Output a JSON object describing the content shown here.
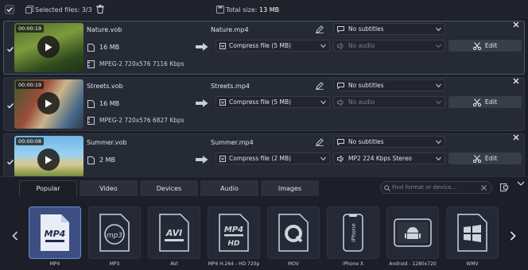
{
  "topbar": {
    "selected_label": "Selected files: 3/3",
    "total_label": "Total size:",
    "total_value": "13 MB"
  },
  "files": [
    {
      "duration": "00:00:19",
      "source_name": "Nature.vob",
      "size": "16 MB",
      "info": "MPEG-2 720x576 7116 Kbps",
      "output_name": "Nature.mp4",
      "compress": "Compress file (5 MB)",
      "subtitles": "No subtitles",
      "audio": "No audio",
      "edit": "Edit"
    },
    {
      "duration": "00:00:19",
      "source_name": "Streets.vob",
      "size": "16 MB",
      "info": "MPEG-2 720x576 6827 Kbps",
      "output_name": "Streets.mp4",
      "compress": "Compress file (5 MB)",
      "subtitles": "No subtitles",
      "audio": "No audio",
      "edit": "Edit"
    },
    {
      "duration": "00:00:08",
      "source_name": "Summer.vob",
      "size": "2 MB",
      "info": "",
      "output_name": "Summer.mp4",
      "compress": "Compress file (2 MB)",
      "subtitles": "No subtitles",
      "audio": "MP2 224 Kbps Stereo",
      "edit": "Edit"
    }
  ],
  "tabs": [
    {
      "label": "Popular",
      "active": true
    },
    {
      "label": "Video",
      "active": false
    },
    {
      "label": "Devices",
      "active": false
    },
    {
      "label": "Audio",
      "active": false
    },
    {
      "label": "Images",
      "active": false
    }
  ],
  "search": {
    "placeholder": "Find format or device..."
  },
  "formats": [
    {
      "label": "MP4",
      "icon": "mp4-video-icon",
      "active": true
    },
    {
      "label": "MP3",
      "icon": "mp3-icon",
      "active": false
    },
    {
      "label": "AVI",
      "icon": "avi-video-icon",
      "active": false
    },
    {
      "label": "MP4 H.264 - HD 720p",
      "icon": "mp4-hd-icon",
      "active": false
    },
    {
      "label": "MOV",
      "icon": "quicktime-icon",
      "active": false
    },
    {
      "label": "iPhone X",
      "icon": "iphone-icon",
      "active": false
    },
    {
      "label": "Android - 1280x720",
      "icon": "android-icon",
      "active": false
    },
    {
      "label": "WMV",
      "icon": "windows-icon",
      "active": false
    }
  ],
  "colors": {
    "accent": "#6b88d8",
    "active_tile": "#3d4f82",
    "panel": "#262a34",
    "background": "#1b1e27"
  }
}
